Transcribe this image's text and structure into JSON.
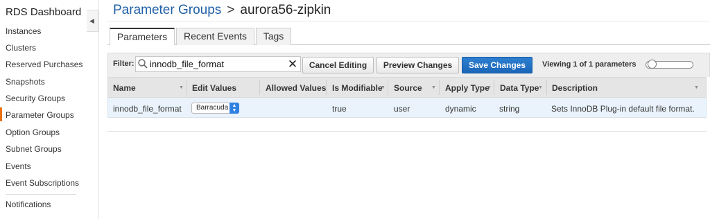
{
  "sidebar": {
    "title": "RDS Dashboard",
    "items": [
      {
        "label": "Instances"
      },
      {
        "label": "Clusters"
      },
      {
        "label": "Reserved Purchases"
      },
      {
        "label": "Snapshots"
      },
      {
        "label": "Security Groups"
      },
      {
        "label": "Parameter Groups",
        "active": true
      },
      {
        "label": "Option Groups"
      },
      {
        "label": "Subnet Groups"
      },
      {
        "label": "Events"
      },
      {
        "label": "Event Subscriptions"
      },
      {
        "label": "Notifications"
      }
    ],
    "active_color": "#ec7211",
    "collapse_icon": "triangle-left-icon"
  },
  "breadcrumb": {
    "parent": "Parameter Groups",
    "separator": ">",
    "current": "aurora56-zipkin"
  },
  "tabs": [
    {
      "label": "Parameters",
      "active": true
    },
    {
      "label": "Recent Events"
    },
    {
      "label": "Tags"
    }
  ],
  "filter": {
    "label": "Filter:",
    "value": "innodb_file_format",
    "search_icon": "magnifier-icon",
    "clear_icon": "close-icon"
  },
  "buttons": {
    "cancel": "Cancel Editing",
    "preview": "Preview Changes",
    "save": "Save Changes"
  },
  "viewing": "Viewing 1 of 1 parameters",
  "table": {
    "columns": [
      "Name",
      "Edit Values",
      "Allowed Values",
      "Is Modifiable",
      "Source",
      "Apply Type",
      "Data Type",
      "Description"
    ],
    "rows": [
      {
        "name": "innodb_file_format",
        "edit_value": "Barracuda",
        "allowed_values": "",
        "is_modifiable": "true",
        "source": "user",
        "apply_type": "dynamic",
        "data_type": "string",
        "description": "Sets InnoDB Plug-in default file format."
      }
    ]
  },
  "colors": {
    "primary_button": "#1a66b8",
    "link": "#1f5fa6",
    "row_highlight": "#eaf3fb"
  }
}
